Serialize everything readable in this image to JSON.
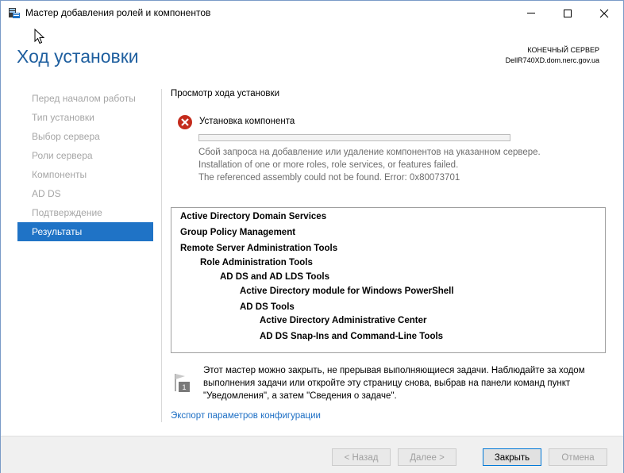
{
  "window": {
    "title": "Мастер добавления ролей и компонентов"
  },
  "header": {
    "page_title": "Ход установки",
    "destination_label": "КОНЕЧНЫЙ СЕРВЕР",
    "destination_server": "DellR740XD.dom.nerc.gov.ua"
  },
  "nav": {
    "items": [
      {
        "label": "Перед началом работы",
        "active": false
      },
      {
        "label": "Тип установки",
        "active": false
      },
      {
        "label": "Выбор сервера",
        "active": false
      },
      {
        "label": "Роли сервера",
        "active": false
      },
      {
        "label": "Компоненты",
        "active": false
      },
      {
        "label": "AD DS",
        "active": false
      },
      {
        "label": "Подтверждение",
        "active": false
      },
      {
        "label": "Результаты",
        "active": true
      }
    ]
  },
  "content": {
    "section_title": "Просмотр хода установки",
    "install_label": "Установка компонента",
    "progress_fraction": 0,
    "error_lines": [
      "Сбой запроса на добавление или удаление компонентов на указанном сервере.",
      "Installation of one or more roles, role services, or features failed.",
      "The referenced assembly could not be found. Error: 0x80073701"
    ],
    "results": [
      {
        "text": "Active Directory Domain Services",
        "level": 0
      },
      {
        "text": "Group Policy Management",
        "level": 0
      },
      {
        "text": "Remote Server Administration Tools",
        "level": 0
      },
      {
        "text": "Role Administration Tools",
        "level": 1
      },
      {
        "text": "AD DS and AD LDS Tools",
        "level": 2
      },
      {
        "text": "Active Directory module for Windows PowerShell",
        "level": 3
      },
      {
        "text": "AD DS Tools",
        "level": 3
      },
      {
        "text": "Active Directory Administrative Center",
        "level": 4
      },
      {
        "text": "AD DS Snap-Ins and Command-Line Tools",
        "level": 4
      }
    ],
    "note_badge": "1",
    "note_lines": [
      "Этот мастер можно закрыть, не прерывая выполняющиеся задачи. Наблюдайте за ходом",
      "выполнения задачи или откройте эту страницу снова, выбрав на панели команд пункт",
      "\"Уведомления\", а затем \"Сведения о задаче\"."
    ],
    "export_link": "Экспорт параметров конфигурации"
  },
  "footer": {
    "back_label": "< Назад",
    "next_label": "Далее >",
    "close_label": "Закрыть",
    "cancel_label": "Отмена"
  },
  "colors": {
    "accent": "#1f73c6",
    "title_blue": "#1f5f9f",
    "error_red": "#c42b1c",
    "link": "#1c6ec4"
  }
}
